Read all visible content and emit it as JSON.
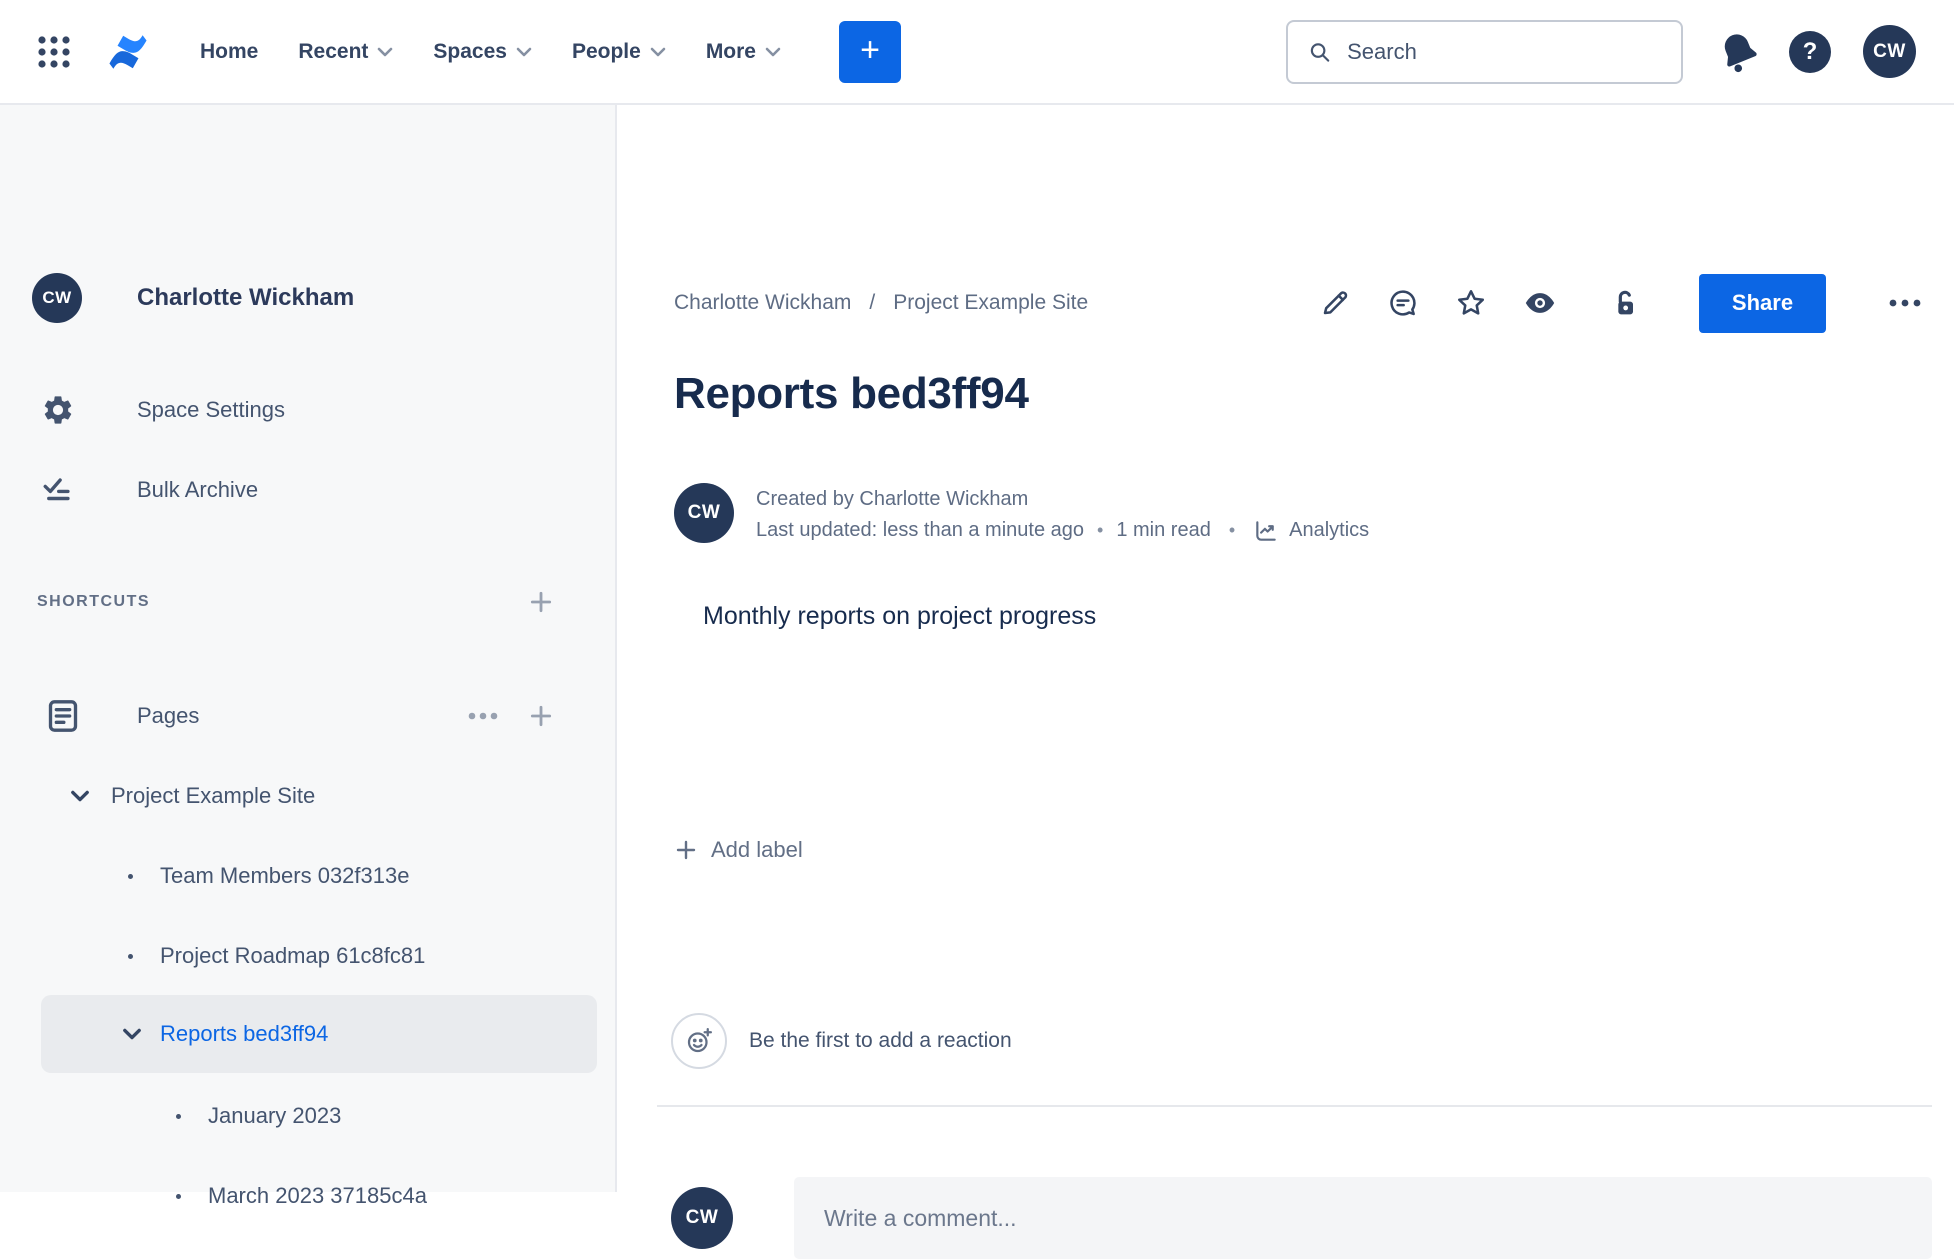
{
  "topnav": {
    "items": [
      {
        "label": "Home",
        "dropdown": false
      },
      {
        "label": "Recent",
        "dropdown": true
      },
      {
        "label": "Spaces",
        "dropdown": true
      },
      {
        "label": "People",
        "dropdown": true
      },
      {
        "label": "More",
        "dropdown": true
      }
    ],
    "create_label": "+",
    "search_placeholder": "Search",
    "help_label": "?",
    "user_initials": "CW"
  },
  "sidebar": {
    "avatar_initials": "CW",
    "space_name": "Charlotte Wickham",
    "menu": [
      {
        "label": "Space Settings"
      },
      {
        "label": "Bulk Archive"
      }
    ],
    "shortcuts_heading": "SHORTCUTS",
    "pages_label": "Pages",
    "tree": {
      "root_label": "Project Example Site",
      "items": [
        {
          "label": "Team Members 032f313e"
        },
        {
          "label": "Project Roadmap 61c8fc81"
        }
      ],
      "selected_label": "Reports bed3ff94",
      "selected_children": [
        {
          "label": "January 2023"
        },
        {
          "label": "March 2023 37185c4a"
        }
      ]
    }
  },
  "content": {
    "breadcrumb": {
      "crumb1": "Charlotte Wickham",
      "separator": "/",
      "crumb2": "Project Example Site"
    },
    "share_label": "Share",
    "title": "Reports bed3ff94",
    "byline": {
      "avatar_initials": "CW",
      "created": "Created by Charlotte Wickham",
      "updated": "Last updated: less than a minute ago",
      "separator": "•",
      "read_time": "1 min read",
      "analytics_label": "Analytics"
    },
    "body_text": "Monthly reports on project progress",
    "add_label": "Add label",
    "reaction_prompt": "Be the first to add a reaction",
    "comment": {
      "avatar_initials": "CW",
      "placeholder": "Write a comment..."
    }
  },
  "icons": {
    "app-switcher": "3x3 dot grid",
    "confluence-logo": "blue dual-ribbon mark",
    "chevron-down": "⌄",
    "plus": "+",
    "ellipsis": "…",
    "search": "magnifier",
    "bell": "notification bell",
    "gear": "settings gear",
    "bulk-archive": "check with lines",
    "pages": "document",
    "edit": "pencil",
    "comment": "speech bubble",
    "star": "star outline",
    "watch": "eye",
    "restrictions": "open padlock",
    "analytics": "trend line chart",
    "reaction": "smiley with plus"
  },
  "colors": {
    "accent_blue": "#0c66e4",
    "navy": "#253858",
    "text_dark": "#172b4d",
    "text_slate": "#44546f",
    "sidebar_bg": "#f7f8f9",
    "selected_bg": "#e9ebee"
  }
}
